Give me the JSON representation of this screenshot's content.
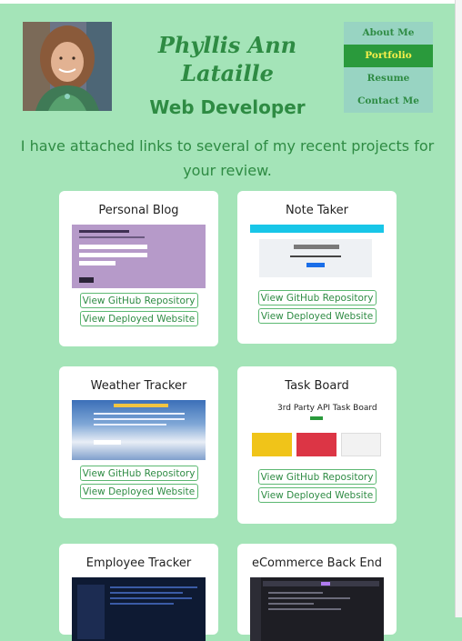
{
  "header": {
    "name": "Phyllis Ann Lataille",
    "role": "Web Developer"
  },
  "nav": {
    "items": [
      {
        "label": "About Me"
      },
      {
        "label": "Portfolio"
      },
      {
        "label": "Resume"
      },
      {
        "label": "Contact Me"
      }
    ],
    "active": "Portfolio"
  },
  "intro": "I have attached links to several of my recent projects for your review.",
  "projects": [
    {
      "title": "Personal Blog",
      "repo_label": "View GitHub Repository",
      "site_label": "View Deployed Website"
    },
    {
      "title": "Note Taker",
      "repo_label": "View GitHub Repository",
      "site_label": "View Deployed Website"
    },
    {
      "title": "Weather Tracker",
      "repo_label": "View GitHub Repository",
      "site_label": "View Deployed Website"
    },
    {
      "title": "Task Board",
      "repo_label": "View GitHub Repository",
      "site_label": "View Deployed Website",
      "thumb_title": "3rd Party API Task Board"
    },
    {
      "title": "Employee Tracker"
    },
    {
      "title": "eCommerce Back End"
    }
  ],
  "colors": {
    "page_background": "#a4e4b8",
    "accent_green": "#2e8b43",
    "nav_background": "#98d4c2",
    "nav_active": "#2a9a3c",
    "nav_active_text": "#f6ef4b"
  }
}
